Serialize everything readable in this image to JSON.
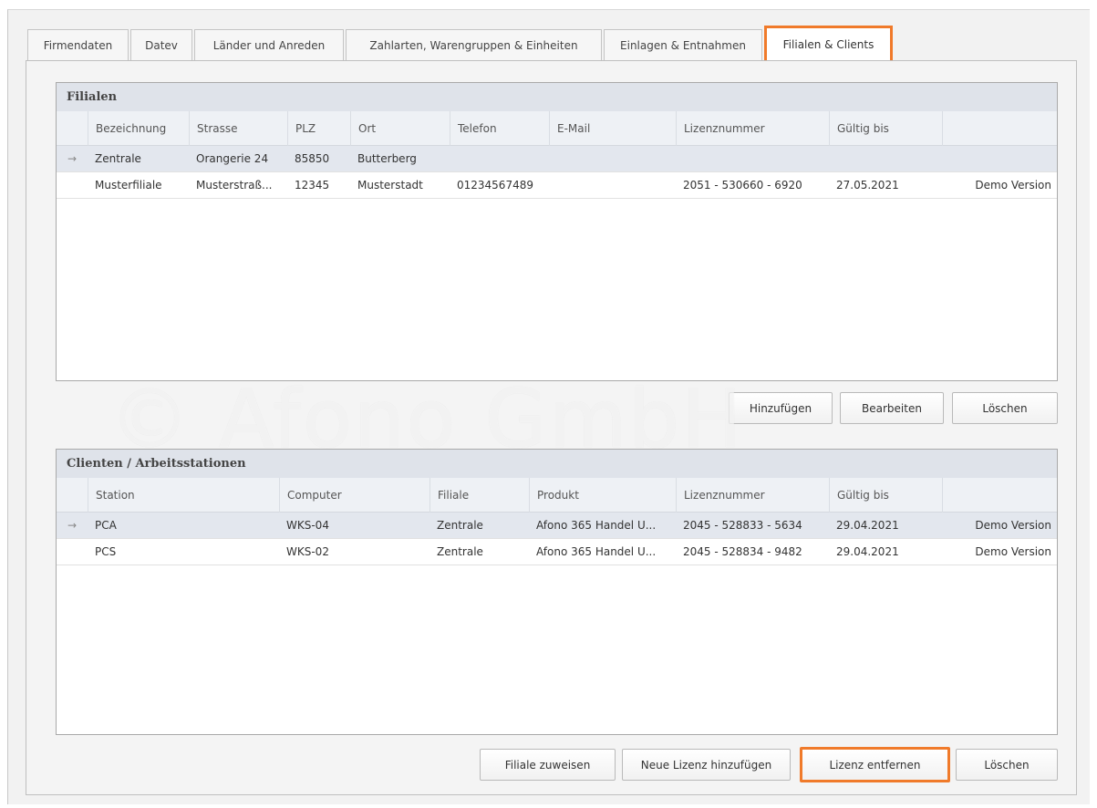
{
  "tabs": [
    {
      "label": "Firmendaten"
    },
    {
      "label": "Datev"
    },
    {
      "label": "Länder und Anreden"
    },
    {
      "label": "Zahlarten, Warengruppen & Einheiten"
    },
    {
      "label": "Einlagen & Entnahmen"
    },
    {
      "label": "Filialen & Clients"
    }
  ],
  "filialen": {
    "title": "Filialen",
    "columns": [
      "Bezeichnung",
      "Strasse",
      "PLZ",
      "Ort",
      "Telefon",
      "E-Mail",
      "Lizenznummer",
      "Gültig bis",
      ""
    ],
    "rows": [
      {
        "indicator": "→",
        "cells": [
          "Zentrale",
          "Orangerie 24",
          "85850",
          "Butterberg",
          "",
          "",
          "",
          "",
          ""
        ]
      },
      {
        "indicator": "",
        "cells": [
          "Musterfiliale",
          "Musterstraß...",
          "12345",
          "Musterstadt",
          "01234567489",
          "",
          "2051 - 530660 - 6920",
          "27.05.2021",
          "Demo Version"
        ]
      }
    ],
    "buttons": {
      "add": "Hinzufügen",
      "edit": "Bearbeiten",
      "delete": "Löschen"
    }
  },
  "clients": {
    "title": "Clienten / Arbeitsstationen",
    "columns": [
      "Station",
      "Computer",
      "Filiale",
      "Produkt",
      "Lizenznummer",
      "Gültig bis",
      ""
    ],
    "rows": [
      {
        "indicator": "→",
        "cells": [
          "PCA",
          "WKS-04",
          "Zentrale",
          "Afono 365 Handel U...",
          "2045 - 528833 - 5634",
          "29.04.2021",
          "Demo Version"
        ]
      },
      {
        "indicator": "",
        "cells": [
          "PCS",
          "WKS-02",
          "Zentrale",
          "Afono 365 Handel U...",
          "2045 - 528834 - 9482",
          "29.04.2021",
          "Demo Version"
        ]
      }
    ],
    "buttons": {
      "assign": "Filiale zuweisen",
      "new_license": "Neue Lizenz hinzufügen",
      "remove_license": "Lizenz entfernen",
      "delete": "Löschen"
    }
  },
  "watermark": "© Afono GmbH",
  "colors": {
    "highlight": "#f07a2a",
    "header_bg": "#dfe3ea",
    "selected_row": "#e3e7ee"
  }
}
